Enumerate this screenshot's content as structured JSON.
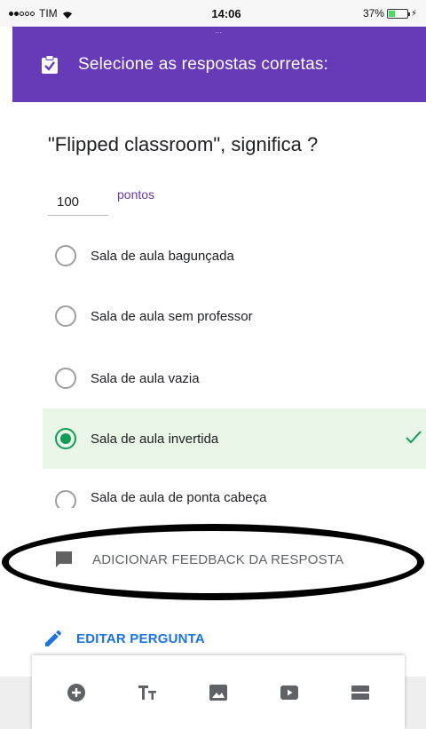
{
  "status_bar": {
    "carrier": "TIM",
    "time": "14:06",
    "battery": "37%"
  },
  "header": {
    "title": "Selecione as respostas corretas:",
    "icon": "clipboard-check-icon"
  },
  "question": {
    "title": "\"Flipped classroom\", significa ?",
    "points_value": "100",
    "points_label": "pontos"
  },
  "options": [
    {
      "label": "Sala de aula bagunçada",
      "selected": false
    },
    {
      "label": "Sala de aula sem professor",
      "selected": false
    },
    {
      "label": "Sala de aula vazia",
      "selected": false
    },
    {
      "label": "Sala de aula invertida",
      "selected": true
    },
    {
      "label": "Sala de aula de ponta cabeça",
      "selected": false
    }
  ],
  "feedback": {
    "label": "ADICIONAR FEEDBACK DA RESPOSTA",
    "icon": "comment-icon"
  },
  "edit": {
    "label": "EDITAR PERGUNTA",
    "icon": "pencil-icon"
  },
  "toolbar": {
    "items": [
      "add-circle-icon",
      "text-format-icon",
      "image-icon",
      "video-icon",
      "section-icon"
    ]
  },
  "colors": {
    "accent": "#673ab7",
    "correct": "#0f9d58",
    "link": "#1a73e8"
  }
}
